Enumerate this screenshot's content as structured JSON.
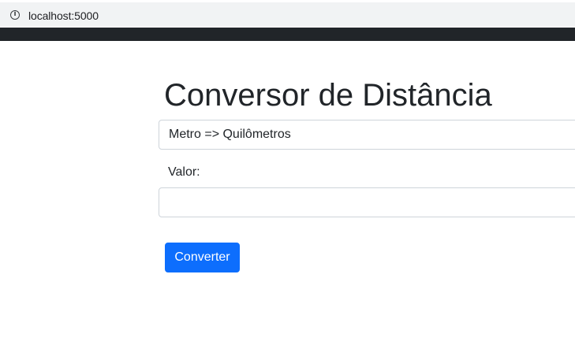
{
  "browser": {
    "url": "localhost:5000"
  },
  "page": {
    "title": "Conversor de Distância"
  },
  "form": {
    "conversion_select": {
      "selected": "Metro => Quilômetros"
    },
    "value_label": "Valor:",
    "value_input": {
      "value": "",
      "placeholder": ""
    },
    "submit_label": "Converter"
  },
  "colors": {
    "navbar": "#212529",
    "primary_button": "#0d6efd",
    "text": "#212529",
    "border": "#ced4da"
  },
  "icons": {
    "address_bar": "info-icon"
  }
}
